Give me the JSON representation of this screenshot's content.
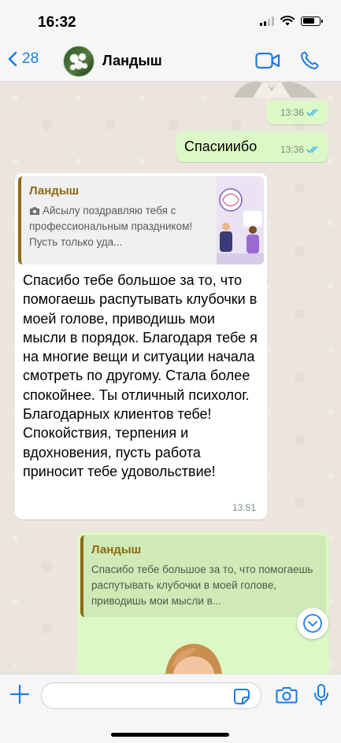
{
  "status_bar": {
    "time": "16:32",
    "battery_level": 0.7,
    "icons": [
      "signal-icon",
      "wifi-icon",
      "battery-icon"
    ]
  },
  "header": {
    "back_count": "28",
    "contact_name": "Ландыш",
    "icons": [
      "chevron-left-icon",
      "video-call-icon",
      "phone-icon"
    ]
  },
  "messages": [
    {
      "direction": "out",
      "time": "13:36",
      "status": "read"
    },
    {
      "direction": "out",
      "text": "Спасииибо",
      "time": "13:36",
      "status": "read"
    },
    {
      "direction": "in",
      "quote": {
        "author": "Ландыш",
        "text": "Айсылу поздравляю тебя с профессиональным праздником! Пусть только уда..."
      },
      "text": "Спасибо тебе большое за то, что помогаешь распутывать клубочки в моей голове, приводишь мои мысли в порядок. Благодаря тебе я на многие вещи и ситуации начала смотреть по другому. Стала более спокойнее. Ты отличный психолог. Благодарных клиентов тебе! Спокойствия, терпения и вдохновения, пусть работа приносит тебе удовольствие!",
      "time": "13:51"
    },
    {
      "direction": "out",
      "quote": {
        "author": "Ландыш",
        "text": "Спасибо тебе большое за то, что помогаешь распутывать клубочки в моей голове, приводишь мои мысли в..."
      }
    }
  ],
  "input": {
    "placeholder": "",
    "value": ""
  },
  "colors": {
    "accent": "#1f7bde",
    "outgoing_bubble": "#dcf8c6",
    "incoming_bubble": "#ffffff",
    "quote_author": "#8c6a12",
    "read_ticks": "#34b7f1",
    "chat_background": "#ece5dd"
  }
}
